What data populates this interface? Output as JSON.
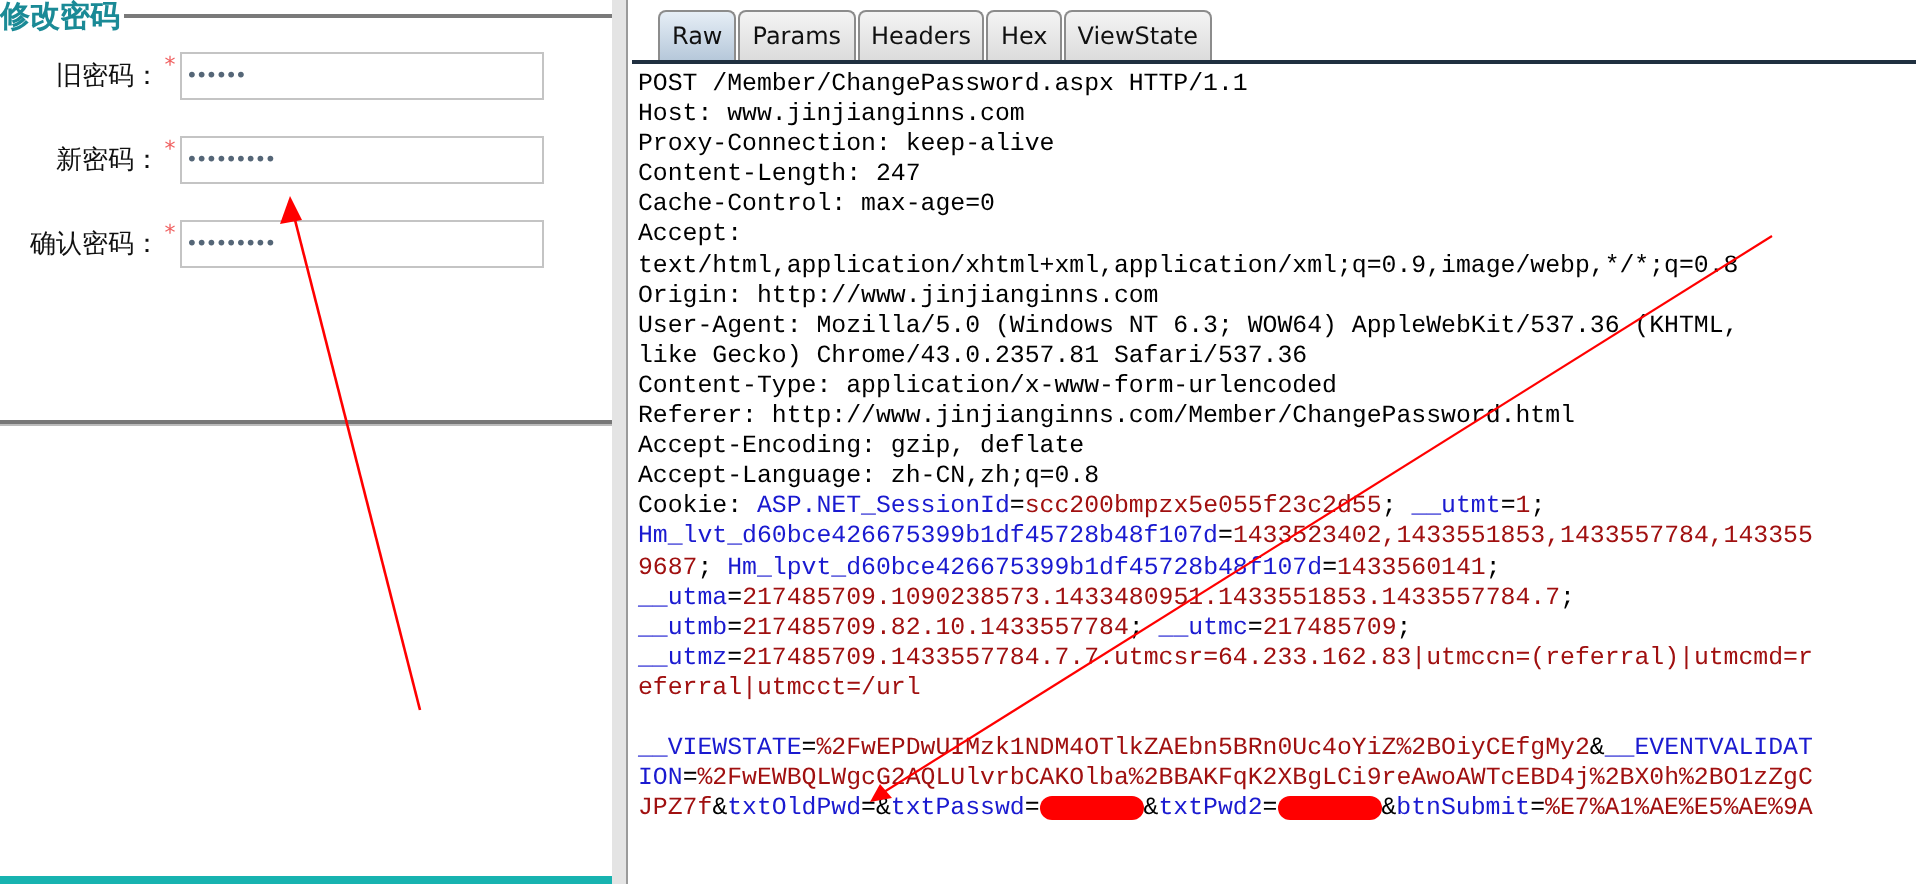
{
  "form": {
    "legend": "修改密码",
    "fields": [
      {
        "label": "旧密码：",
        "required_mark": "*",
        "value": "••••••"
      },
      {
        "label": "新密码：",
        "required_mark": "*",
        "value": "•••••••••"
      },
      {
        "label": "确认密码：",
        "required_mark": "*",
        "value": "•••••••••"
      }
    ]
  },
  "request_tabs": [
    {
      "label": "Raw",
      "selected": true
    },
    {
      "label": "Params",
      "selected": false
    },
    {
      "label": "Headers",
      "selected": false
    },
    {
      "label": "Hex",
      "selected": false
    },
    {
      "label": "ViewState",
      "selected": false
    }
  ],
  "raw_lines": [
    {
      "kind": "text",
      "segments": [
        {
          "kind": "plain",
          "text": "POST /Member/ChangePassword.aspx HTTP/1.1"
        }
      ]
    },
    {
      "kind": "text",
      "segments": [
        {
          "kind": "plain",
          "text": "Host: www.jinjianginns.com"
        }
      ]
    },
    {
      "kind": "text",
      "segments": [
        {
          "kind": "plain",
          "text": "Proxy-Connection: keep-alive"
        }
      ]
    },
    {
      "kind": "text",
      "segments": [
        {
          "kind": "plain",
          "text": "Content-Length: 247"
        }
      ]
    },
    {
      "kind": "text",
      "segments": [
        {
          "kind": "plain",
          "text": "Cache-Control: max-age=0"
        }
      ]
    },
    {
      "kind": "text",
      "segments": [
        {
          "kind": "plain",
          "text": "Accept:"
        }
      ]
    },
    {
      "kind": "text",
      "segments": [
        {
          "kind": "plain",
          "text": "text/html,application/xhtml+xml,application/xml;q=0.9,image/webp,*/*;q=0.8"
        }
      ]
    },
    {
      "kind": "text",
      "segments": [
        {
          "kind": "plain",
          "text": "Origin: http://www.jinjianginns.com"
        }
      ]
    },
    {
      "kind": "text",
      "segments": [
        {
          "kind": "plain",
          "text": "User-Agent: Mozilla/5.0 (Windows NT 6.3; WOW64) AppleWebKit/537.36 (KHTML,"
        }
      ]
    },
    {
      "kind": "text",
      "segments": [
        {
          "kind": "plain",
          "text": "like Gecko) Chrome/43.0.2357.81 Safari/537.36"
        }
      ]
    },
    {
      "kind": "text",
      "segments": [
        {
          "kind": "plain",
          "text": "Content-Type: application/x-www-form-urlencoded"
        }
      ]
    },
    {
      "kind": "text",
      "segments": [
        {
          "kind": "plain",
          "text": "Referer: http://www.jinjianginns.com/Member/ChangePassword.html"
        }
      ]
    },
    {
      "kind": "text",
      "segments": [
        {
          "kind": "plain",
          "text": "Accept-Encoding: gzip, deflate"
        }
      ]
    },
    {
      "kind": "text",
      "segments": [
        {
          "kind": "plain",
          "text": "Accept-Language: zh-CN,zh;q=0.8"
        }
      ]
    },
    {
      "kind": "text",
      "segments": [
        {
          "kind": "plain",
          "text": "Cookie: "
        },
        {
          "kind": "key",
          "text": "ASP.NET_SessionId"
        },
        {
          "kind": "plain",
          "text": "="
        },
        {
          "kind": "value",
          "text": "scc200bmpzx5e055f23c2d55"
        },
        {
          "kind": "plain",
          "text": "; "
        },
        {
          "kind": "key",
          "text": "__utmt"
        },
        {
          "kind": "plain",
          "text": "="
        },
        {
          "kind": "value",
          "text": "1"
        },
        {
          "kind": "plain",
          "text": ";"
        }
      ]
    },
    {
      "kind": "text",
      "segments": [
        {
          "kind": "key",
          "text": "Hm_lvt_d60bce426675399b1df45728b48f107d"
        },
        {
          "kind": "plain",
          "text": "="
        },
        {
          "kind": "value",
          "text": "1433523402,1433551853,1433557784,143355"
        }
      ]
    },
    {
      "kind": "text",
      "segments": [
        {
          "kind": "value",
          "text": "9687"
        },
        {
          "kind": "plain",
          "text": "; "
        },
        {
          "kind": "key",
          "text": "Hm_lpvt_d60bce426675399b1df45728b48f107d"
        },
        {
          "kind": "plain",
          "text": "="
        },
        {
          "kind": "value",
          "text": "1433560141"
        },
        {
          "kind": "plain",
          "text": ";"
        }
      ]
    },
    {
      "kind": "text",
      "segments": [
        {
          "kind": "key",
          "text": "__utma"
        },
        {
          "kind": "plain",
          "text": "="
        },
        {
          "kind": "value",
          "text": "217485709.1090238573.1433480951.1433551853.1433557784.7"
        },
        {
          "kind": "plain",
          "text": ";"
        }
      ]
    },
    {
      "kind": "text",
      "segments": [
        {
          "kind": "key",
          "text": "__utmb"
        },
        {
          "kind": "plain",
          "text": "="
        },
        {
          "kind": "value",
          "text": "217485709.82.10.1433557784"
        },
        {
          "kind": "plain",
          "text": "; "
        },
        {
          "kind": "key",
          "text": "__utmc"
        },
        {
          "kind": "plain",
          "text": "="
        },
        {
          "kind": "value",
          "text": "217485709"
        },
        {
          "kind": "plain",
          "text": ";"
        }
      ]
    },
    {
      "kind": "text",
      "segments": [
        {
          "kind": "key",
          "text": "__utmz"
        },
        {
          "kind": "plain",
          "text": "="
        },
        {
          "kind": "value",
          "text": "217485709.1433557784.7.7.utmcsr=64.233.162.83|utmccn=(referral)|utmcmd=r"
        }
      ]
    },
    {
      "kind": "text",
      "segments": [
        {
          "kind": "value",
          "text": "eferral|utmcct=/url"
        }
      ]
    },
    {
      "kind": "blank"
    },
    {
      "kind": "text",
      "segments": [
        {
          "kind": "key",
          "text": "__VIEWSTATE"
        },
        {
          "kind": "plain",
          "text": "="
        },
        {
          "kind": "value",
          "text": "%2FwEPDwUIMzk1NDM4OTlkZAEbn5BRn0Uc4oYiZ%2BOiyCEfgMy2"
        },
        {
          "kind": "plain",
          "text": "&"
        },
        {
          "kind": "key",
          "text": "__EVENTVALIDAT"
        }
      ]
    },
    {
      "kind": "text",
      "segments": [
        {
          "kind": "key",
          "text": "ION"
        },
        {
          "kind": "plain",
          "text": "="
        },
        {
          "kind": "value",
          "text": "%2FwEWBQLWgcG2AQLUlvrbCAKOlba%2BBAKFqK2XBgLCi9reAwoAWTcEBD4j%2BX0h%2BO1zZgC"
        }
      ]
    },
    {
      "kind": "text",
      "segments": [
        {
          "kind": "value",
          "text": "JPZ7f"
        },
        {
          "kind": "plain",
          "text": "&"
        },
        {
          "kind": "key",
          "text": "txtOldPwd"
        },
        {
          "kind": "plain",
          "text": "="
        },
        {
          "kind": "plain",
          "text": "&"
        },
        {
          "kind": "key",
          "text": "txtPasswd"
        },
        {
          "kind": "plain",
          "text": "="
        },
        {
          "kind": "redacted"
        },
        {
          "kind": "plain",
          "text": "&"
        },
        {
          "kind": "key",
          "text": "txtPwd2"
        },
        {
          "kind": "plain",
          "text": "="
        },
        {
          "kind": "redacted"
        },
        {
          "kind": "plain",
          "text": "&"
        },
        {
          "kind": "key",
          "text": "btnSubmit"
        },
        {
          "kind": "plain",
          "text": "="
        },
        {
          "kind": "value",
          "text": "%E7%A1%AE%E5%AE%9A"
        }
      ]
    }
  ]
}
